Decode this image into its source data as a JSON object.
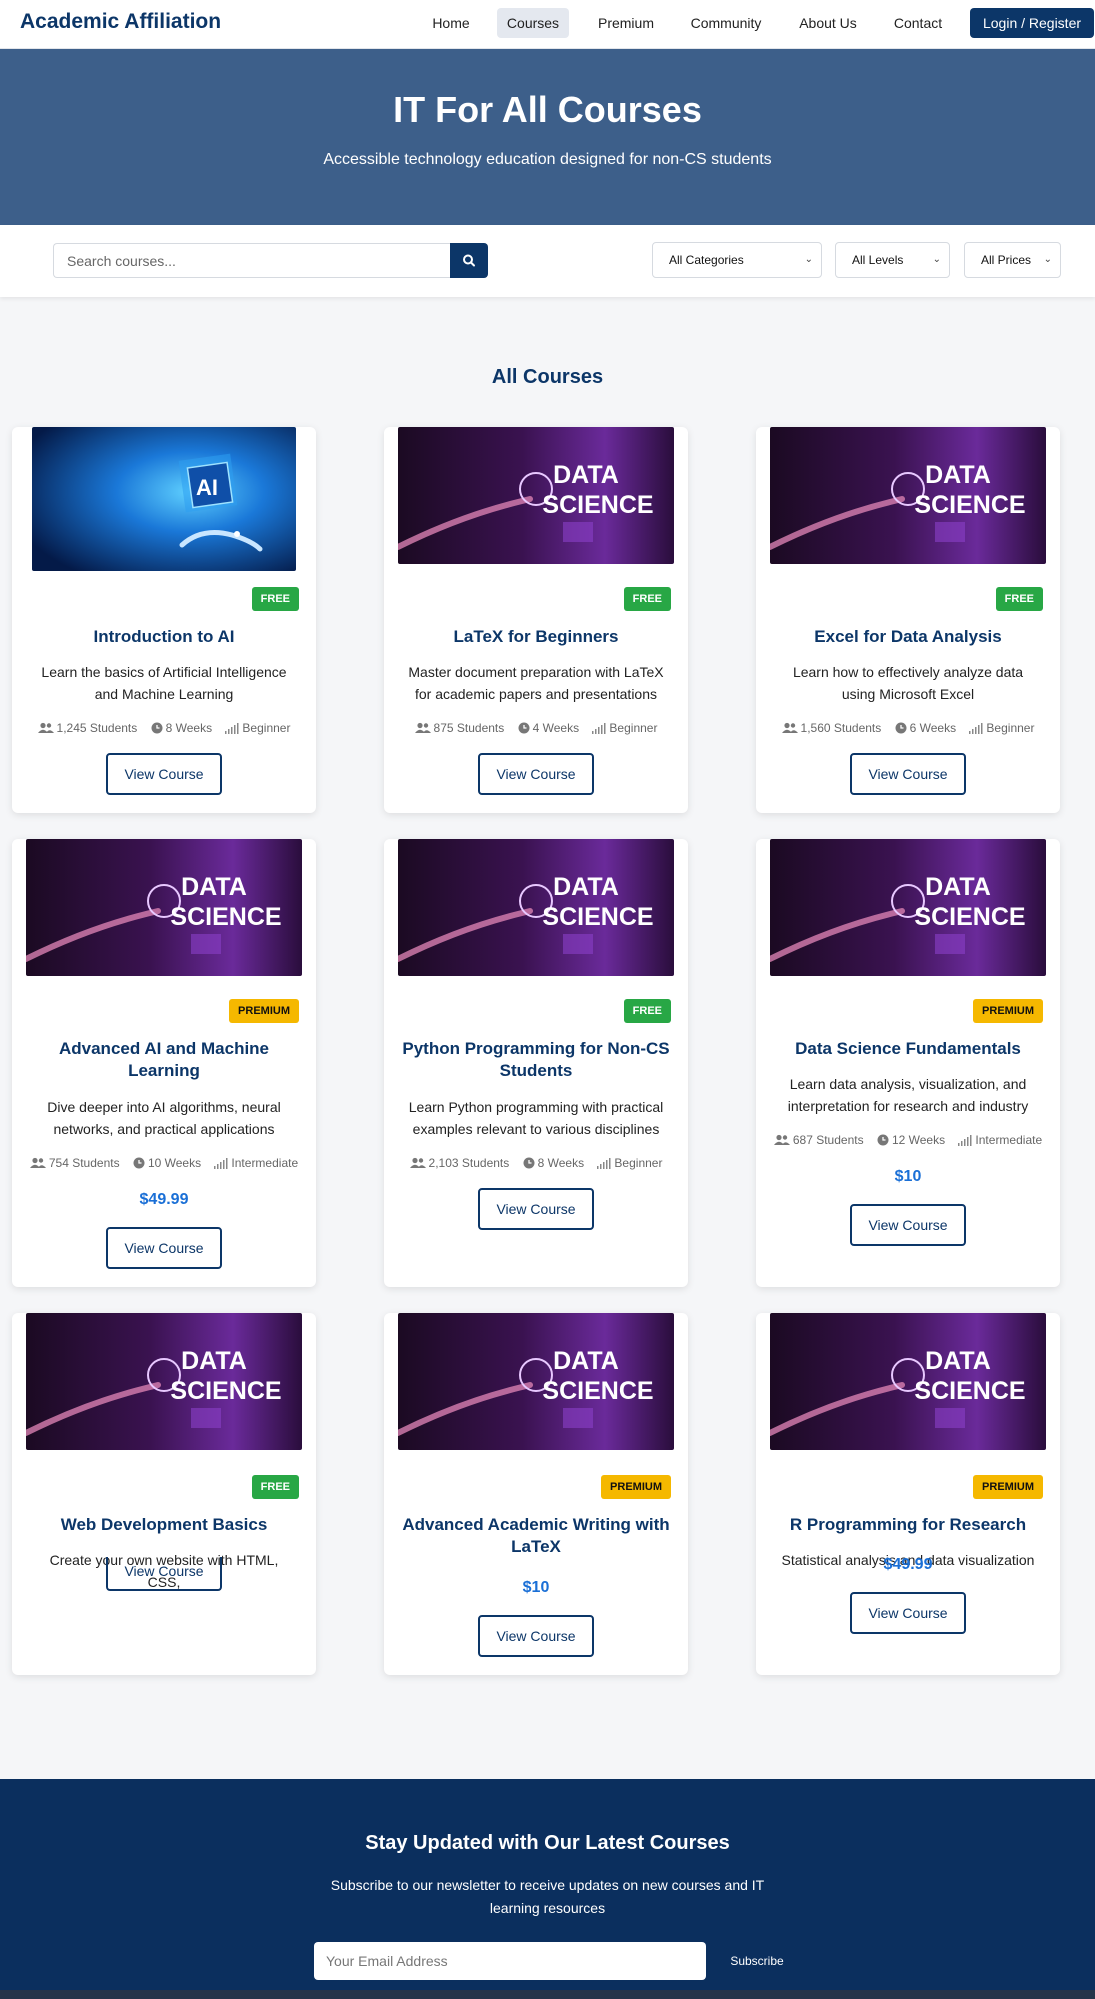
{
  "header": {
    "brand": "Academic Affiliation",
    "nav": [
      "Home",
      "Courses",
      "Premium",
      "Community",
      "About Us",
      "Contact"
    ],
    "active_nav": "Courses",
    "login_label": "Login / Register"
  },
  "hero": {
    "title": "IT For All Courses",
    "subtitle": "Accessible technology education designed for non-CS students"
  },
  "filters": {
    "search_placeholder": "Search courses...",
    "search_icon": "search-icon",
    "category": "All Categories",
    "level": "All Levels",
    "price": "All Prices"
  },
  "section": {
    "title": "All Courses"
  },
  "courses": [
    {
      "title": "Introduction to AI",
      "badge": "FREE",
      "image": "ai",
      "description": "Learn the basics of Artificial Intelligence and Machine Learning",
      "students": "1,245 Students",
      "duration": "8 Weeks",
      "level": "Beginner",
      "price": "",
      "button": "View Course"
    },
    {
      "title": "LaTeX for Beginners",
      "badge": "FREE",
      "image": "data-science",
      "description": "Master document preparation with LaTeX for academic papers and presentations",
      "students": "875 Students",
      "duration": "4 Weeks",
      "level": "Beginner",
      "price": "",
      "button": "View Course"
    },
    {
      "title": "Excel for Data Analysis",
      "badge": "FREE",
      "image": "data-science",
      "description": "Learn how to effectively analyze data using Microsoft Excel",
      "students": "1,560 Students",
      "duration": "6 Weeks",
      "level": "Beginner",
      "price": "",
      "button": "View Course"
    },
    {
      "title": "Advanced AI and Machine Learning",
      "badge": "PREMIUM",
      "image": "data-science",
      "description": "Dive deeper into AI algorithms, neural networks, and practical applications",
      "students": "754 Students",
      "duration": "10 Weeks",
      "level": "Intermediate",
      "price": "$49.99",
      "button": "View Course"
    },
    {
      "title": "Python Programming for Non-CS Students",
      "badge": "FREE",
      "image": "data-science",
      "description": "Learn Python programming with practical examples relevant to various disciplines",
      "students": "2,103 Students",
      "duration": "8 Weeks",
      "level": "Beginner",
      "price": "",
      "button": "View Course"
    },
    {
      "title": "Data Science Fundamentals",
      "badge": "PREMIUM",
      "image": "data-science",
      "description": "Learn data analysis, visualization, and interpretation for research and industry",
      "students": "687 Students",
      "duration": "12 Weeks",
      "level": "Intermediate",
      "price": "$10",
      "button": "View Course"
    },
    {
      "title": "Web Development Basics",
      "badge": "FREE",
      "image": "data-science",
      "description": "Create your own website with HTML, CSS,",
      "students": "",
      "duration": "",
      "level": "",
      "price": "",
      "button": "View Course"
    },
    {
      "title": "Advanced Academic Writing with LaTeX",
      "badge": "PREMIUM",
      "image": "data-science",
      "description": "",
      "students": "",
      "duration": "",
      "level": "",
      "price": "$10",
      "button": "View Course"
    },
    {
      "title": "R Programming for Research",
      "badge": "PREMIUM",
      "image": "data-science",
      "description": "Statistical analysis and data visualization",
      "students": "",
      "duration": "",
      "level": "",
      "price": "$49.99",
      "button": "View Course"
    }
  ],
  "newsletter": {
    "title": "Stay Updated with Our Latest Courses",
    "text": "Subscribe to our newsletter to receive updates on new courses and IT learning resources",
    "email_placeholder": "Your Email Address",
    "subscribe_label": "Subscribe"
  },
  "colors": {
    "primary": "#0c3668",
    "hero": "#3d5f8a",
    "free_badge": "#28a745",
    "premium_badge": "#f5b800",
    "price": "#1a6fd6",
    "newsletter_bg": "#0b2f5e"
  }
}
